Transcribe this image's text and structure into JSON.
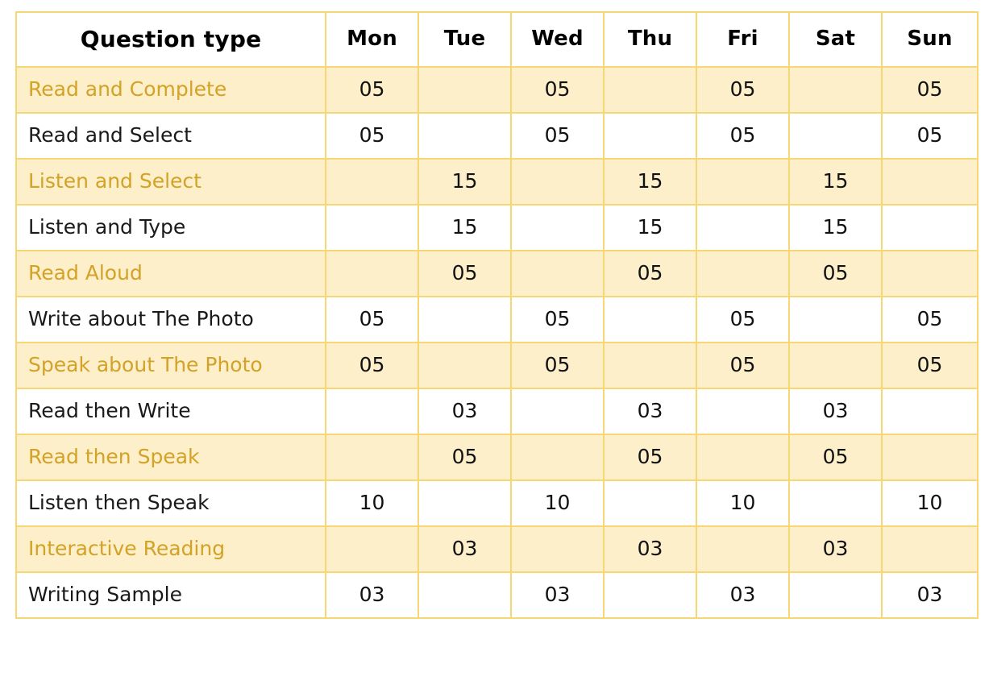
{
  "table": {
    "headers": [
      "Question type",
      "Mon",
      "Tue",
      "Wed",
      "Thu",
      "Fri",
      "Sat",
      "Sun"
    ],
    "rows": [
      {
        "type": "Read and Complete",
        "highlight": true,
        "values": [
          "05",
          "",
          "05",
          "",
          "05",
          "",
          "05"
        ]
      },
      {
        "type": "Read and Select",
        "highlight": false,
        "values": [
          "05",
          "",
          "05",
          "",
          "05",
          "",
          "05"
        ]
      },
      {
        "type": "Listen and Select",
        "highlight": true,
        "values": [
          "",
          "15",
          "",
          "15",
          "",
          "15",
          ""
        ]
      },
      {
        "type": "Listen and Type",
        "highlight": false,
        "values": [
          "",
          "15",
          "",
          "15",
          "",
          "15",
          ""
        ]
      },
      {
        "type": "Read Aloud",
        "highlight": true,
        "values": [
          "",
          "05",
          "",
          "05",
          "",
          "05",
          ""
        ]
      },
      {
        "type": "Write about The Photo",
        "highlight": false,
        "values": [
          "05",
          "",
          "05",
          "",
          "05",
          "",
          "05"
        ]
      },
      {
        "type": "Speak about The Photo",
        "highlight": true,
        "values": [
          "05",
          "",
          "05",
          "",
          "05",
          "",
          "05"
        ]
      },
      {
        "type": "Read then Write",
        "highlight": false,
        "values": [
          "",
          "03",
          "",
          "03",
          "",
          "03",
          ""
        ]
      },
      {
        "type": "Read then Speak",
        "highlight": true,
        "values": [
          "",
          "05",
          "",
          "05",
          "",
          "05",
          ""
        ]
      },
      {
        "type": "Listen then Speak",
        "highlight": false,
        "values": [
          "10",
          "",
          "10",
          "",
          "10",
          "",
          "10"
        ]
      },
      {
        "type": "Interactive Reading",
        "highlight": true,
        "values": [
          "",
          "03",
          "",
          "03",
          "",
          "03",
          ""
        ]
      },
      {
        "type": "Writing Sample",
        "highlight": false,
        "values": [
          "03",
          "",
          "03",
          "",
          "03",
          "",
          "03"
        ]
      }
    ]
  },
  "colors": {
    "border": "#F7D774",
    "highlight_background": "#FCEFC9",
    "highlight_text": "#D3A226",
    "plain_background": "#FFFFFF",
    "plain_text": "#1A1A1A",
    "header_text": "#000000"
  }
}
